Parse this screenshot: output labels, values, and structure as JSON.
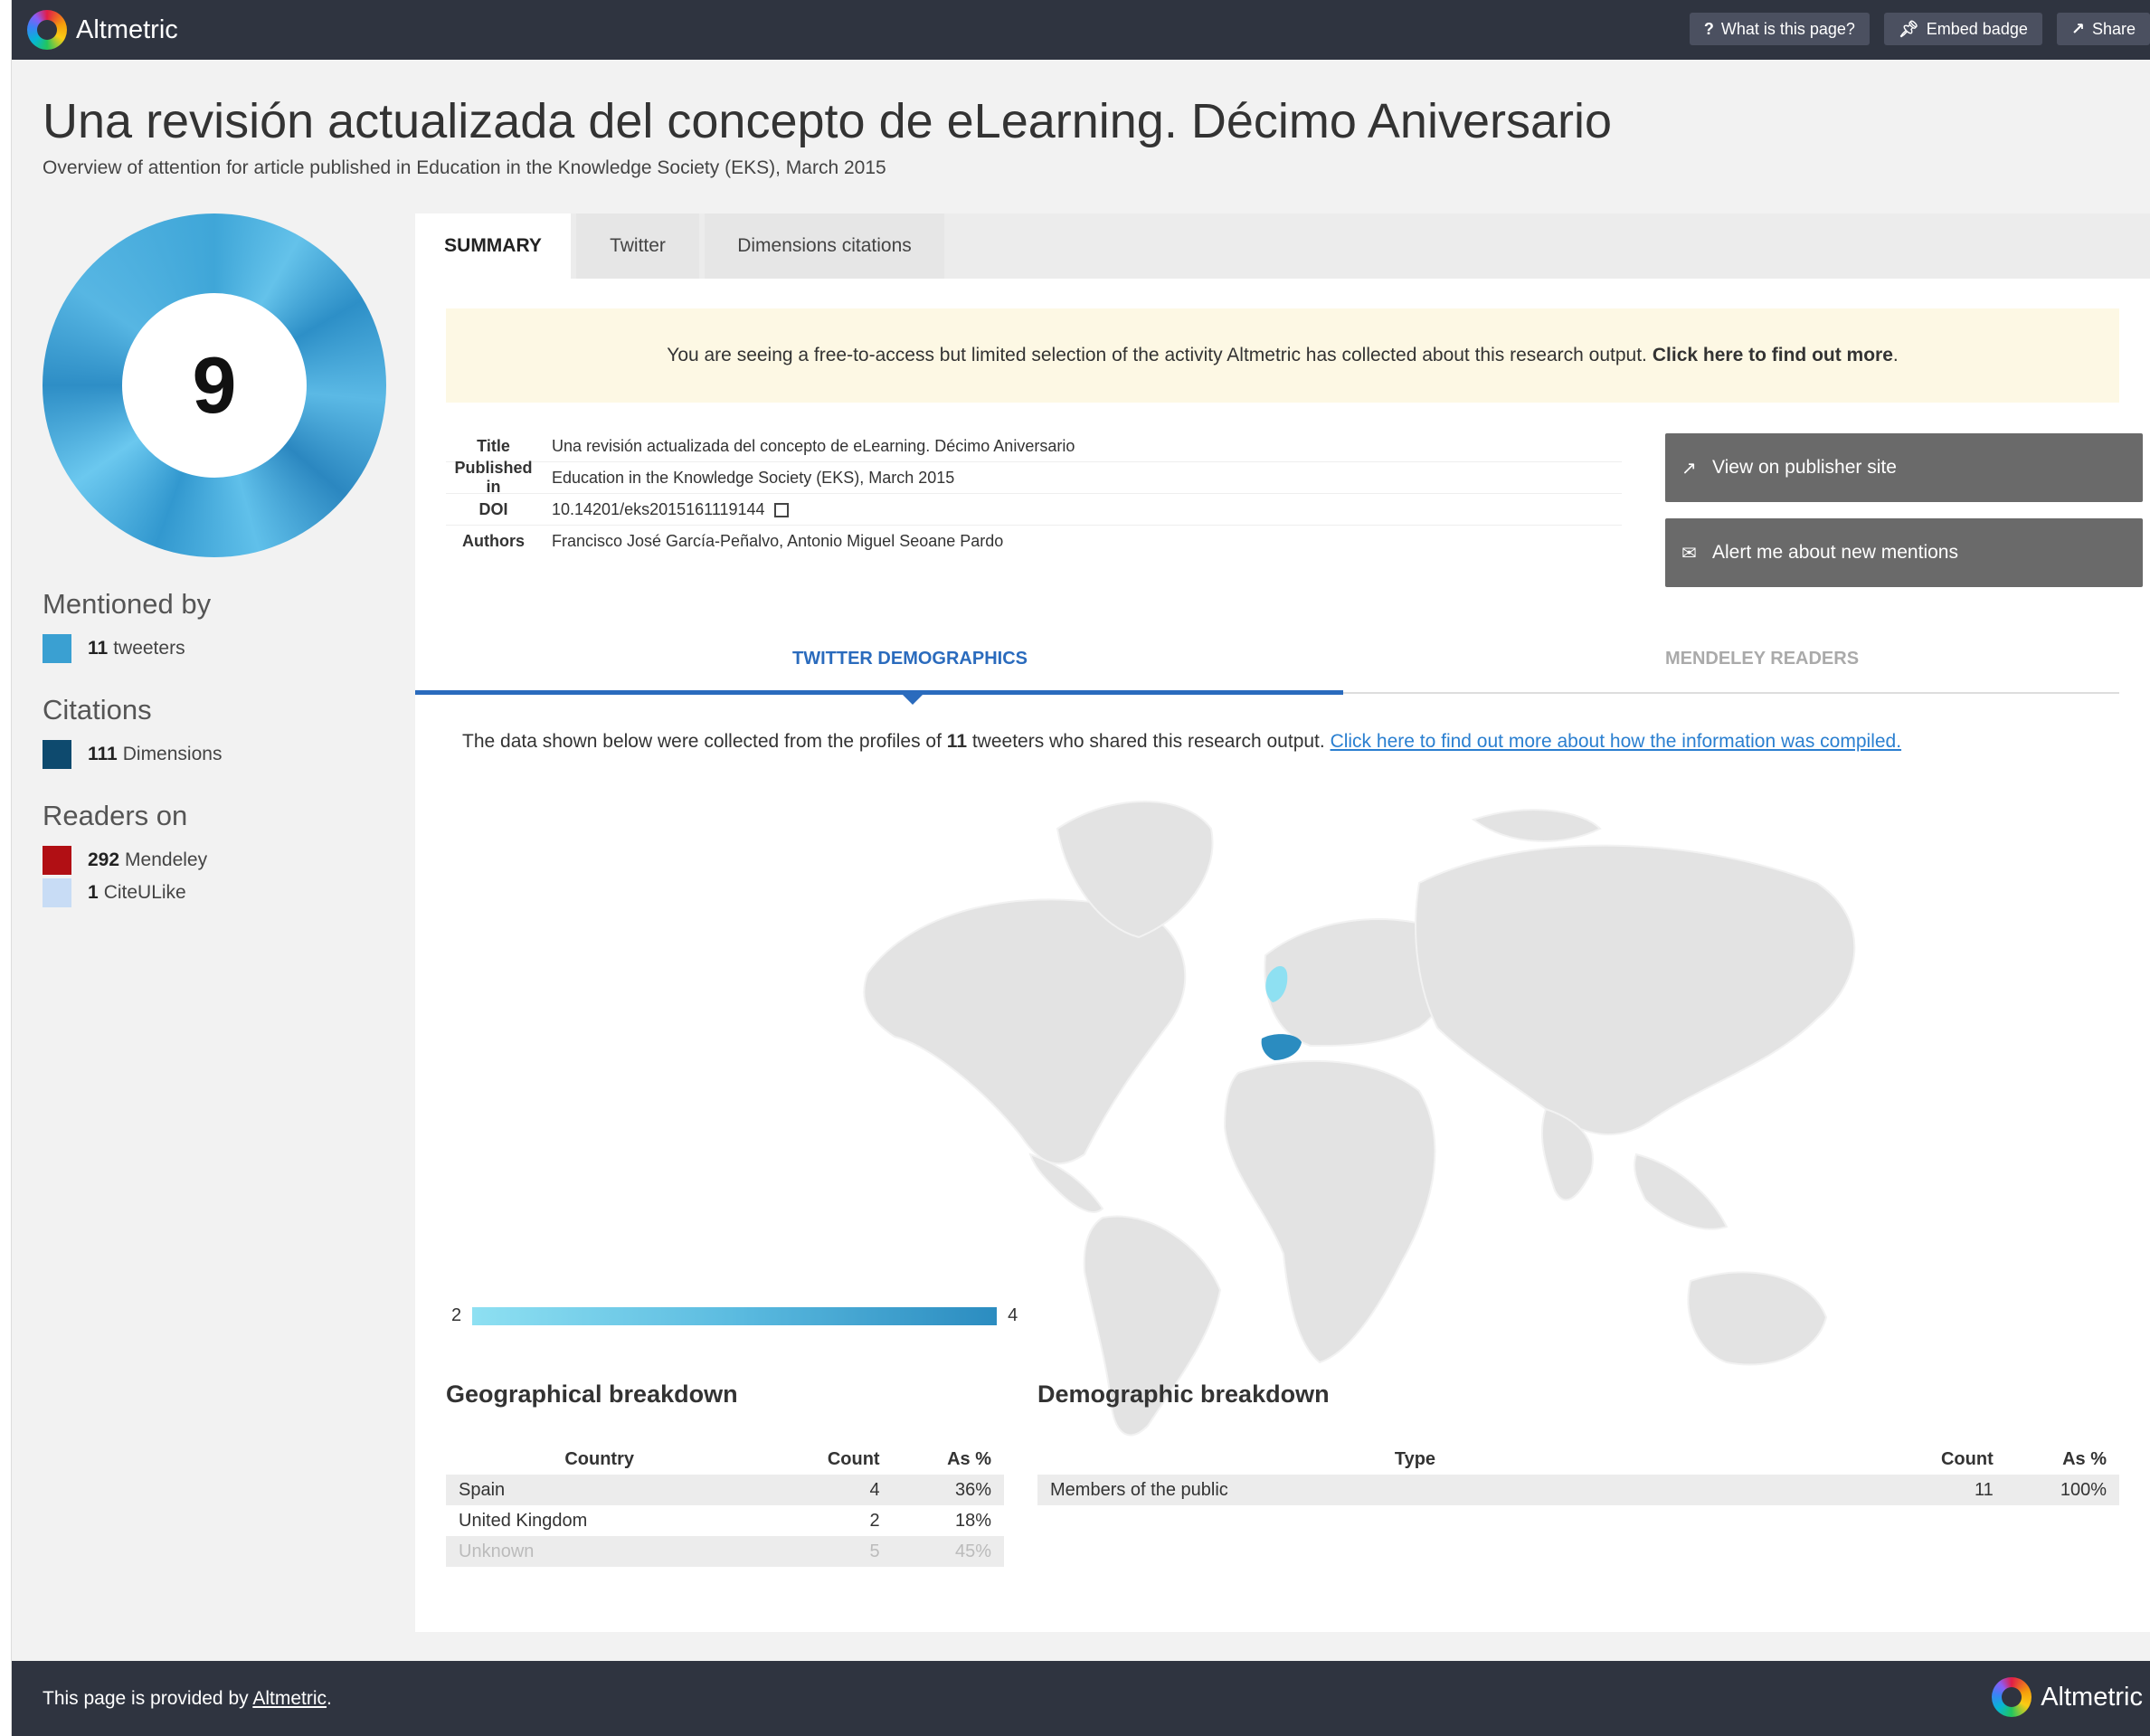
{
  "app": {
    "brand": "Altmetric"
  },
  "topbar": {
    "what_is_label": "What is this page?",
    "embed_label": "Embed badge",
    "share_label": "Share"
  },
  "article": {
    "title": "Una revisión actualizada del concepto de eLearning. Décimo Aniversario",
    "overview": "Overview of attention for article published in Education in the Knowledge Society (EKS), March 2015"
  },
  "score": {
    "value": "9"
  },
  "sidebar": {
    "mentioned_by_heading": "Mentioned by",
    "mentioned_by": [
      {
        "count": "11",
        "label": "tweeters",
        "color": "#3aa0d2"
      }
    ],
    "citations_heading": "Citations",
    "citations": [
      {
        "count": "111",
        "label": "Dimensions",
        "color": "#0e4a6e"
      }
    ],
    "readers_heading": "Readers on",
    "readers": [
      {
        "count": "292",
        "label": "Mendeley",
        "color": "#b10f14"
      },
      {
        "count": "1",
        "label": "CiteULike",
        "color": "#c8dcf5"
      }
    ]
  },
  "tabs": [
    {
      "label": "SUMMARY",
      "active": true
    },
    {
      "label": "Twitter",
      "active": false
    },
    {
      "label": "Dimensions citations",
      "active": false
    }
  ],
  "notice": {
    "text": "You are seeing a free-to-access but limited selection of the activity Altmetric has collected about this research output.",
    "link_text": "Click here to find out more",
    "end": "."
  },
  "meta": {
    "title_label": "Title",
    "title_value": "Una revisión actualizada del concepto de eLearning. Décimo Aniversario",
    "published_label": "Published in",
    "published_value": "Education in the Knowledge Society (EKS), March 2015",
    "doi_label": "DOI",
    "doi_value": "10.14201/eks2015161119144",
    "authors_label": "Authors",
    "authors_value": "Francisco José García-Peñalvo, Antonio Miguel Seoane Pardo"
  },
  "actions": {
    "publisher_label": "View on publisher site",
    "alert_label": "Alert me about new mentions"
  },
  "subtabs": {
    "twitter": "TWITTER DEMOGRAPHICS",
    "mendeley": "MENDELEY READERS"
  },
  "description": {
    "prefix": "The data shown below were collected from the profiles of",
    "count": "11",
    "suffix": "tweeters who shared this research output.",
    "link": "Click here to find out more about how the information was compiled."
  },
  "map_legend": {
    "min": "2",
    "max": "4"
  },
  "geo": {
    "title": "Geographical breakdown",
    "headers": [
      "Country",
      "Count",
      "As %"
    ],
    "rows": [
      [
        "Spain",
        "4",
        "36%"
      ],
      [
        "United Kingdom",
        "2",
        "18%"
      ],
      [
        "Unknown",
        "5",
        "45%"
      ]
    ]
  },
  "demo": {
    "title": "Demographic breakdown",
    "headers": [
      "Type",
      "Count",
      "As %"
    ],
    "rows": [
      [
        "Members of the public",
        "11",
        "100%"
      ]
    ]
  },
  "footer": {
    "text": "This page is provided by",
    "link": "Altmetric",
    "end": ".",
    "brand": "Altmetric"
  },
  "colors": {
    "topbar": "#2f3440",
    "accent": "#2a6bbd",
    "map_spain": "#2b8cc0",
    "map_uk": "#8ee0f2"
  }
}
